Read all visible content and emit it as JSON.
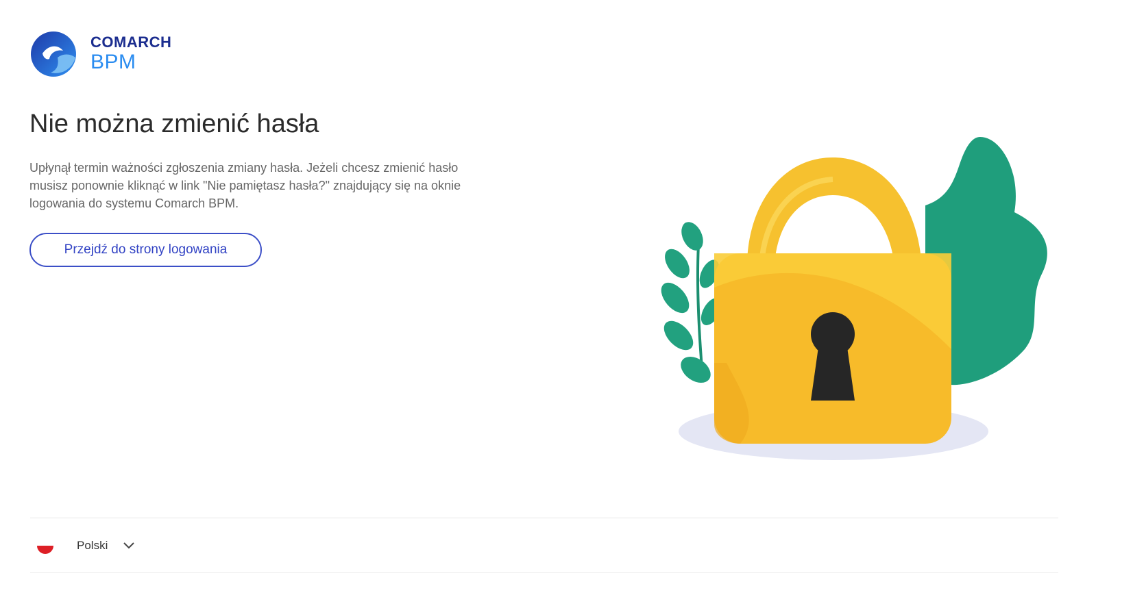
{
  "brand": {
    "name_top": "COMARCH",
    "name_bottom": "BPM",
    "primary_color": "#1b2d8f",
    "accent_color": "#2a8cf0"
  },
  "main": {
    "title": "Nie można zmienić hasła",
    "description": "Upłynął termin ważności zgłoszenia zmiany hasła. Jeżeli chcesz zmienić hasło musisz ponownie kliknąć w link \"Nie pamiętasz hasła?\" znajdujący się na oknie logowania do systemu Comarch BPM.",
    "button_label": "Przejdź do strony logowania",
    "button_color": "#3c4fc7"
  },
  "illustration": {
    "icon": "padlock-icon",
    "lock_color": "#f5b82a",
    "leaf_color": "#1f9e7c"
  },
  "footer": {
    "language": "Polski",
    "flag_icon": "poland-flag-icon",
    "dropdown_icon": "chevron-down-icon"
  }
}
